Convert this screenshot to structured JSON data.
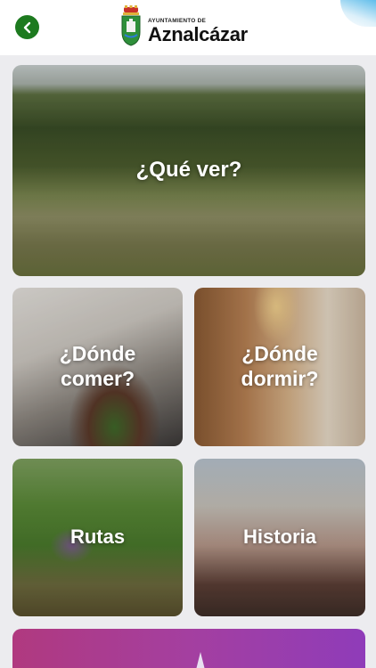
{
  "header": {
    "logo_subtitle": "AYUNTAMIENTO DE",
    "logo_title": "Aznalcázar"
  },
  "tiles": [
    {
      "label": "¿Qué ver?"
    },
    {
      "label": "¿Dónde comer?"
    },
    {
      "label": "¿Dónde dormir?"
    },
    {
      "label": "Rutas"
    },
    {
      "label": "Historia"
    }
  ],
  "colors": {
    "accent_green": "#1d7a1f",
    "bottom_tile_gradient": [
      "#b0397f",
      "#8f3cb9"
    ]
  },
  "icons": {
    "back": "chevron-left-icon",
    "crest": "coat-of-arms-icon"
  }
}
